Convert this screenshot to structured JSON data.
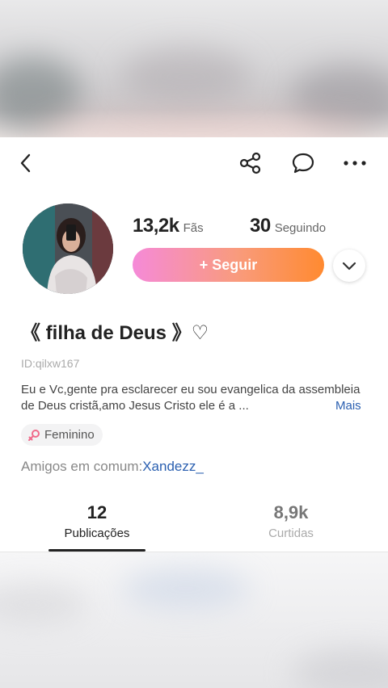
{
  "header": {
    "back_icon": "back-chevron-icon",
    "share_icon": "share-icon",
    "chat_icon": "chat-bubble-icon",
    "more_icon": "more-dots-icon"
  },
  "profile": {
    "fans_count": "13,2k",
    "fans_label": "Fãs",
    "following_count": "30",
    "following_label": "Seguindo",
    "follow_button": "+ Seguir",
    "name": "《 filha de Deus 》♡",
    "id": "ID:qilxw167",
    "bio": "Eu e Vc,gente pra esclarecer eu sou evangelica da assembleia de Deus cristã,amo Jesus Cristo ele é a ...",
    "bio_more": "Mais",
    "gender": "Feminino",
    "mutual_friends_label": "Amigos em comum:",
    "mutual_friends_name": "Xandezz_"
  },
  "tabs": [
    {
      "count": "12",
      "label": "Publicações",
      "active": true
    },
    {
      "count": "8,9k",
      "label": "Curtidas",
      "active": false
    }
  ],
  "colors": {
    "follow_gradient_start": "#f58ad8",
    "follow_gradient_end": "#ff8a30",
    "link": "#2a5fb0"
  }
}
